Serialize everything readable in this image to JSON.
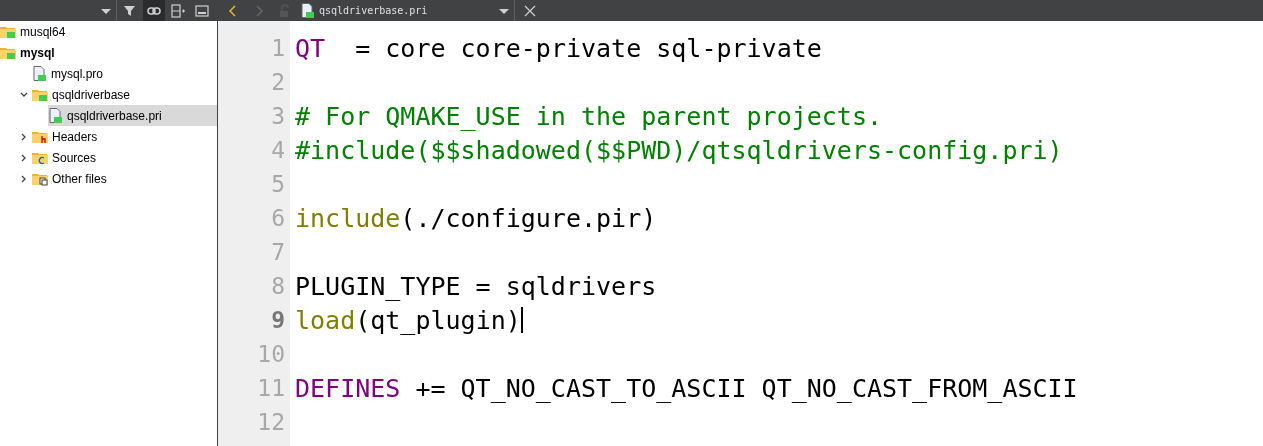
{
  "sidebar": {
    "toolbar": [
      {
        "kind": "dropdown",
        "selected": false
      },
      {
        "kind": "filter",
        "selected": false
      },
      {
        "kind": "link",
        "selected": true
      },
      {
        "kind": "split",
        "selected": false
      },
      {
        "kind": "image",
        "selected": false
      }
    ],
    "tree": [
      {
        "label": "musql64",
        "kind": "qt-folder",
        "bold": false,
        "selected": false
      },
      {
        "label": "mysql",
        "kind": "qt-folder",
        "bold": true,
        "selected": false,
        "children": [
          {
            "label": "mysql.pro",
            "kind": "qt-file",
            "bold": false,
            "selected": false
          },
          {
            "label": "qsqldriverbase",
            "kind": "qt-folder",
            "bold": false,
            "selected": false,
            "expanded": true,
            "children": [
              {
                "label": "qsqldriverbase.pri",
                "kind": "qt-file",
                "bold": false,
                "selected": true
              }
            ]
          },
          {
            "label": "Headers",
            "kind": "header-folder",
            "bold": false,
            "selected": false,
            "expanded": false
          },
          {
            "label": "Sources",
            "kind": "source-folder",
            "bold": false,
            "selected": false,
            "expanded": false
          },
          {
            "label": "Other files",
            "kind": "other-folder",
            "bold": false,
            "selected": false,
            "expanded": false
          }
        ]
      }
    ]
  },
  "editor": {
    "back_enabled": true,
    "forward_enabled": false,
    "file_tab": "qsqldriverbase.pri",
    "lines": [
      {
        "number": "1",
        "current": false,
        "tokens": [
          {
            "kind": "keyword",
            "text": "QT"
          },
          {
            "kind": "plain",
            "text": "  = core core-private sql-private"
          }
        ]
      },
      {
        "number": "2",
        "current": false
      },
      {
        "number": "3",
        "current": false,
        "tokens": [
          {
            "kind": "comment",
            "text": "# For QMAKE_USE in the parent projects."
          }
        ]
      },
      {
        "number": "4",
        "current": false,
        "tokens": [
          {
            "kind": "comment",
            "text": "#include($$shadowed($$PWD)/qtsqldrivers-config.pri)"
          }
        ]
      },
      {
        "number": "5",
        "current": false
      },
      {
        "number": "6",
        "current": false,
        "tokens": [
          {
            "kind": "function",
            "text": "include"
          },
          {
            "kind": "plain",
            "text": "(./configure.pir)"
          }
        ]
      },
      {
        "number": "7",
        "current": false
      },
      {
        "number": "8",
        "current": false,
        "tokens": [
          {
            "kind": "plain",
            "text": "PLUGIN_TYPE = sqldrivers"
          }
        ]
      },
      {
        "number": "9",
        "current": true,
        "tokens": [
          {
            "kind": "function",
            "text": "load"
          },
          {
            "kind": "plain",
            "text": "(qt_plugin)"
          }
        ]
      },
      {
        "number": "10",
        "current": false
      },
      {
        "number": "11",
        "current": false,
        "tokens": [
          {
            "kind": "keyword",
            "text": "DEFINES"
          },
          {
            "kind": "plain",
            "text": " += QT_NO_CAST_TO_ASCII QT_NO_CAST_FROM_ASCII"
          }
        ]
      },
      {
        "number": "12",
        "current": false
      }
    ]
  }
}
